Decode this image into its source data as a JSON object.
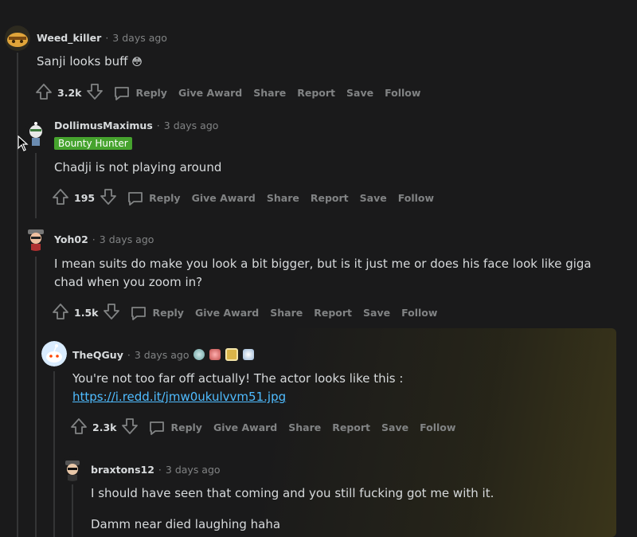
{
  "actions": {
    "reply": "Reply",
    "give_award": "Give Award",
    "share": "Share",
    "report": "Report",
    "save": "Save",
    "follow": "Follow"
  },
  "comments": [
    {
      "username": "Weed_killer",
      "time": "3 days ago",
      "text": "Sanji looks buff",
      "emoji": "😳",
      "votes": "3.2k"
    },
    {
      "username": "DollimusMaximus",
      "time": "3 days ago",
      "flair": "Bounty Hunter",
      "text": "Chadji is not playing around",
      "votes": "195"
    },
    {
      "username": "Yoh02",
      "time": "3 days ago",
      "text_line1": "I mean suits do make you look a bit bigger, but is it just me or does his face look like giga",
      "text_line2": "chad when you zoom in?",
      "votes": "1.5k"
    },
    {
      "username": "TheQGuy",
      "time": "3 days ago",
      "awards": [
        "silver-award-icon",
        "heart-award-icon",
        "frame-award-icon",
        "sparkle-award-icon"
      ],
      "text": "You're not too far off actually! The actor looks like this :",
      "link": "https://i.redd.it/jmw0ukulvvm51.jpg",
      "votes": "2.3k"
    },
    {
      "username": "braxtons12",
      "time": "3 days ago",
      "text_line1": "I should have seen that coming and you still fucking got me with it.",
      "text_line2": "Damm near died laughing haha"
    }
  ],
  "colors": {
    "background": "#1a1a1b",
    "text": "#d7dadc",
    "muted": "#818384",
    "link": "#4fbcff",
    "flair": "#46a32e"
  }
}
